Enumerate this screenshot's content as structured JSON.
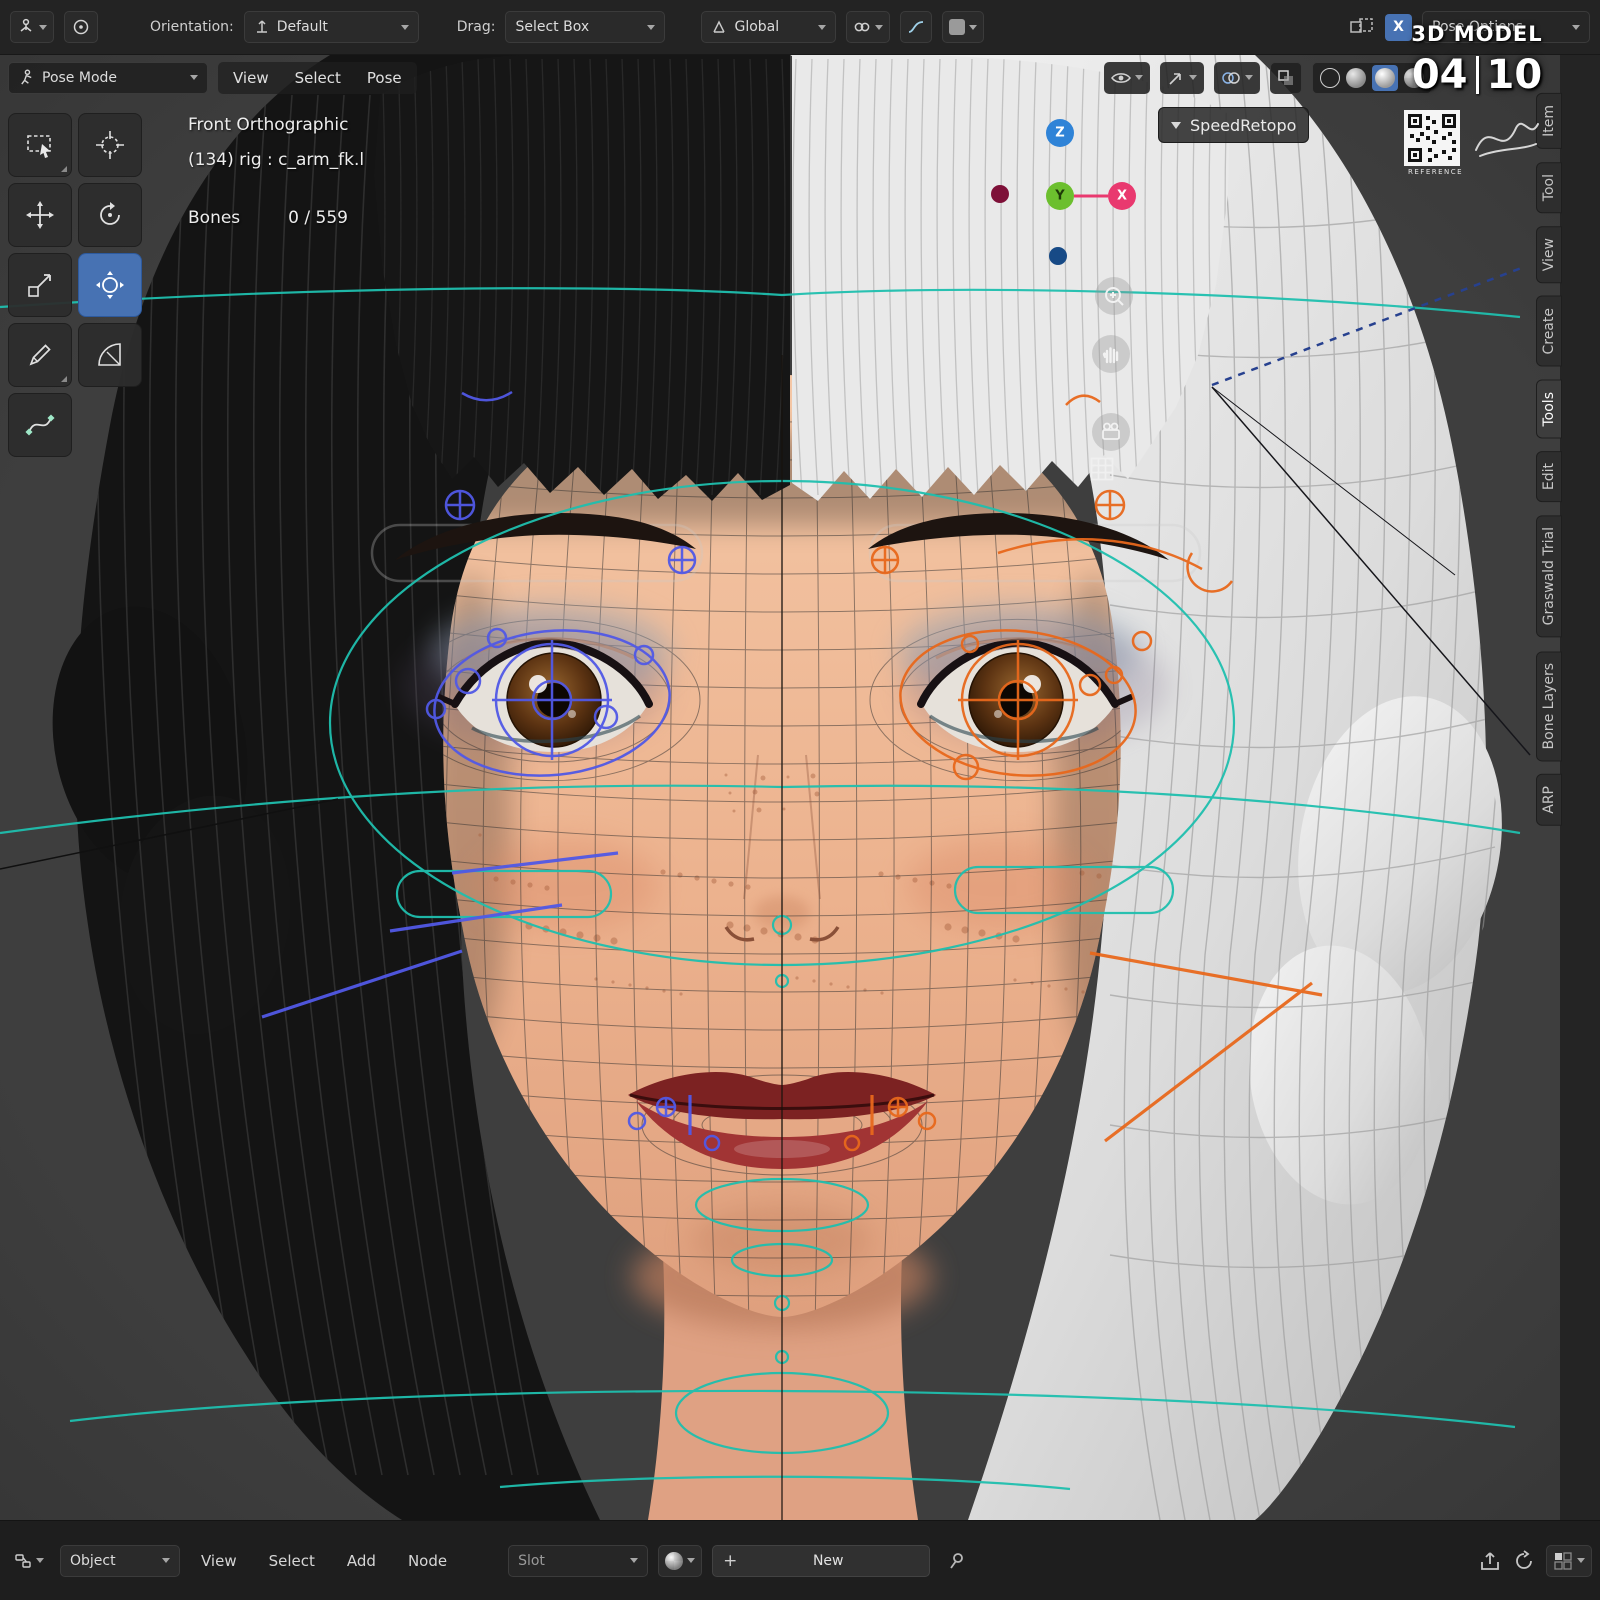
{
  "colors": {
    "accent": "#4772b3",
    "rig_left_blue": "#5159e6",
    "rig_right_orange": "#e8681c",
    "rig_center_teal": "#1fbfae",
    "axis_x": "#e9396f",
    "axis_y": "#6cbf2e",
    "axis_z": "#2f83d7"
  },
  "header": {
    "orientation_label": "Orientation:",
    "orientation_value": "Default",
    "drag_label": "Drag:",
    "drag_value": "Select Box",
    "transform_space": "Global",
    "xray_label": "X",
    "pose_options_label": "Pose Options"
  },
  "mode_row": {
    "mode_label": "Pose Mode",
    "menus": [
      "View",
      "Select",
      "Pose"
    ]
  },
  "viewport": {
    "view_name": "Front Orthographic",
    "active_bone": "(134) rig : c_arm_fk.l",
    "bones_label": "Bones",
    "bones_value": "0 / 559",
    "panel_label": "SpeedRetopo"
  },
  "watermark": {
    "title": "3D MODEL",
    "page_current": "04",
    "page_total": "10",
    "reference_label": "REFERENCE"
  },
  "gizmo": {
    "x": "X",
    "y": "Y",
    "z": "Z"
  },
  "side_tabs": [
    "Item",
    "Tool",
    "View",
    "Create",
    "Tools",
    "Edit",
    "Graswald Trial",
    "Bone Layers",
    "ARP"
  ],
  "footer": {
    "shader_type": "Object",
    "menus": [
      "View",
      "Select",
      "Add",
      "Node"
    ],
    "slot_label": "Slot",
    "plus_label": "+",
    "new_label": "New"
  }
}
